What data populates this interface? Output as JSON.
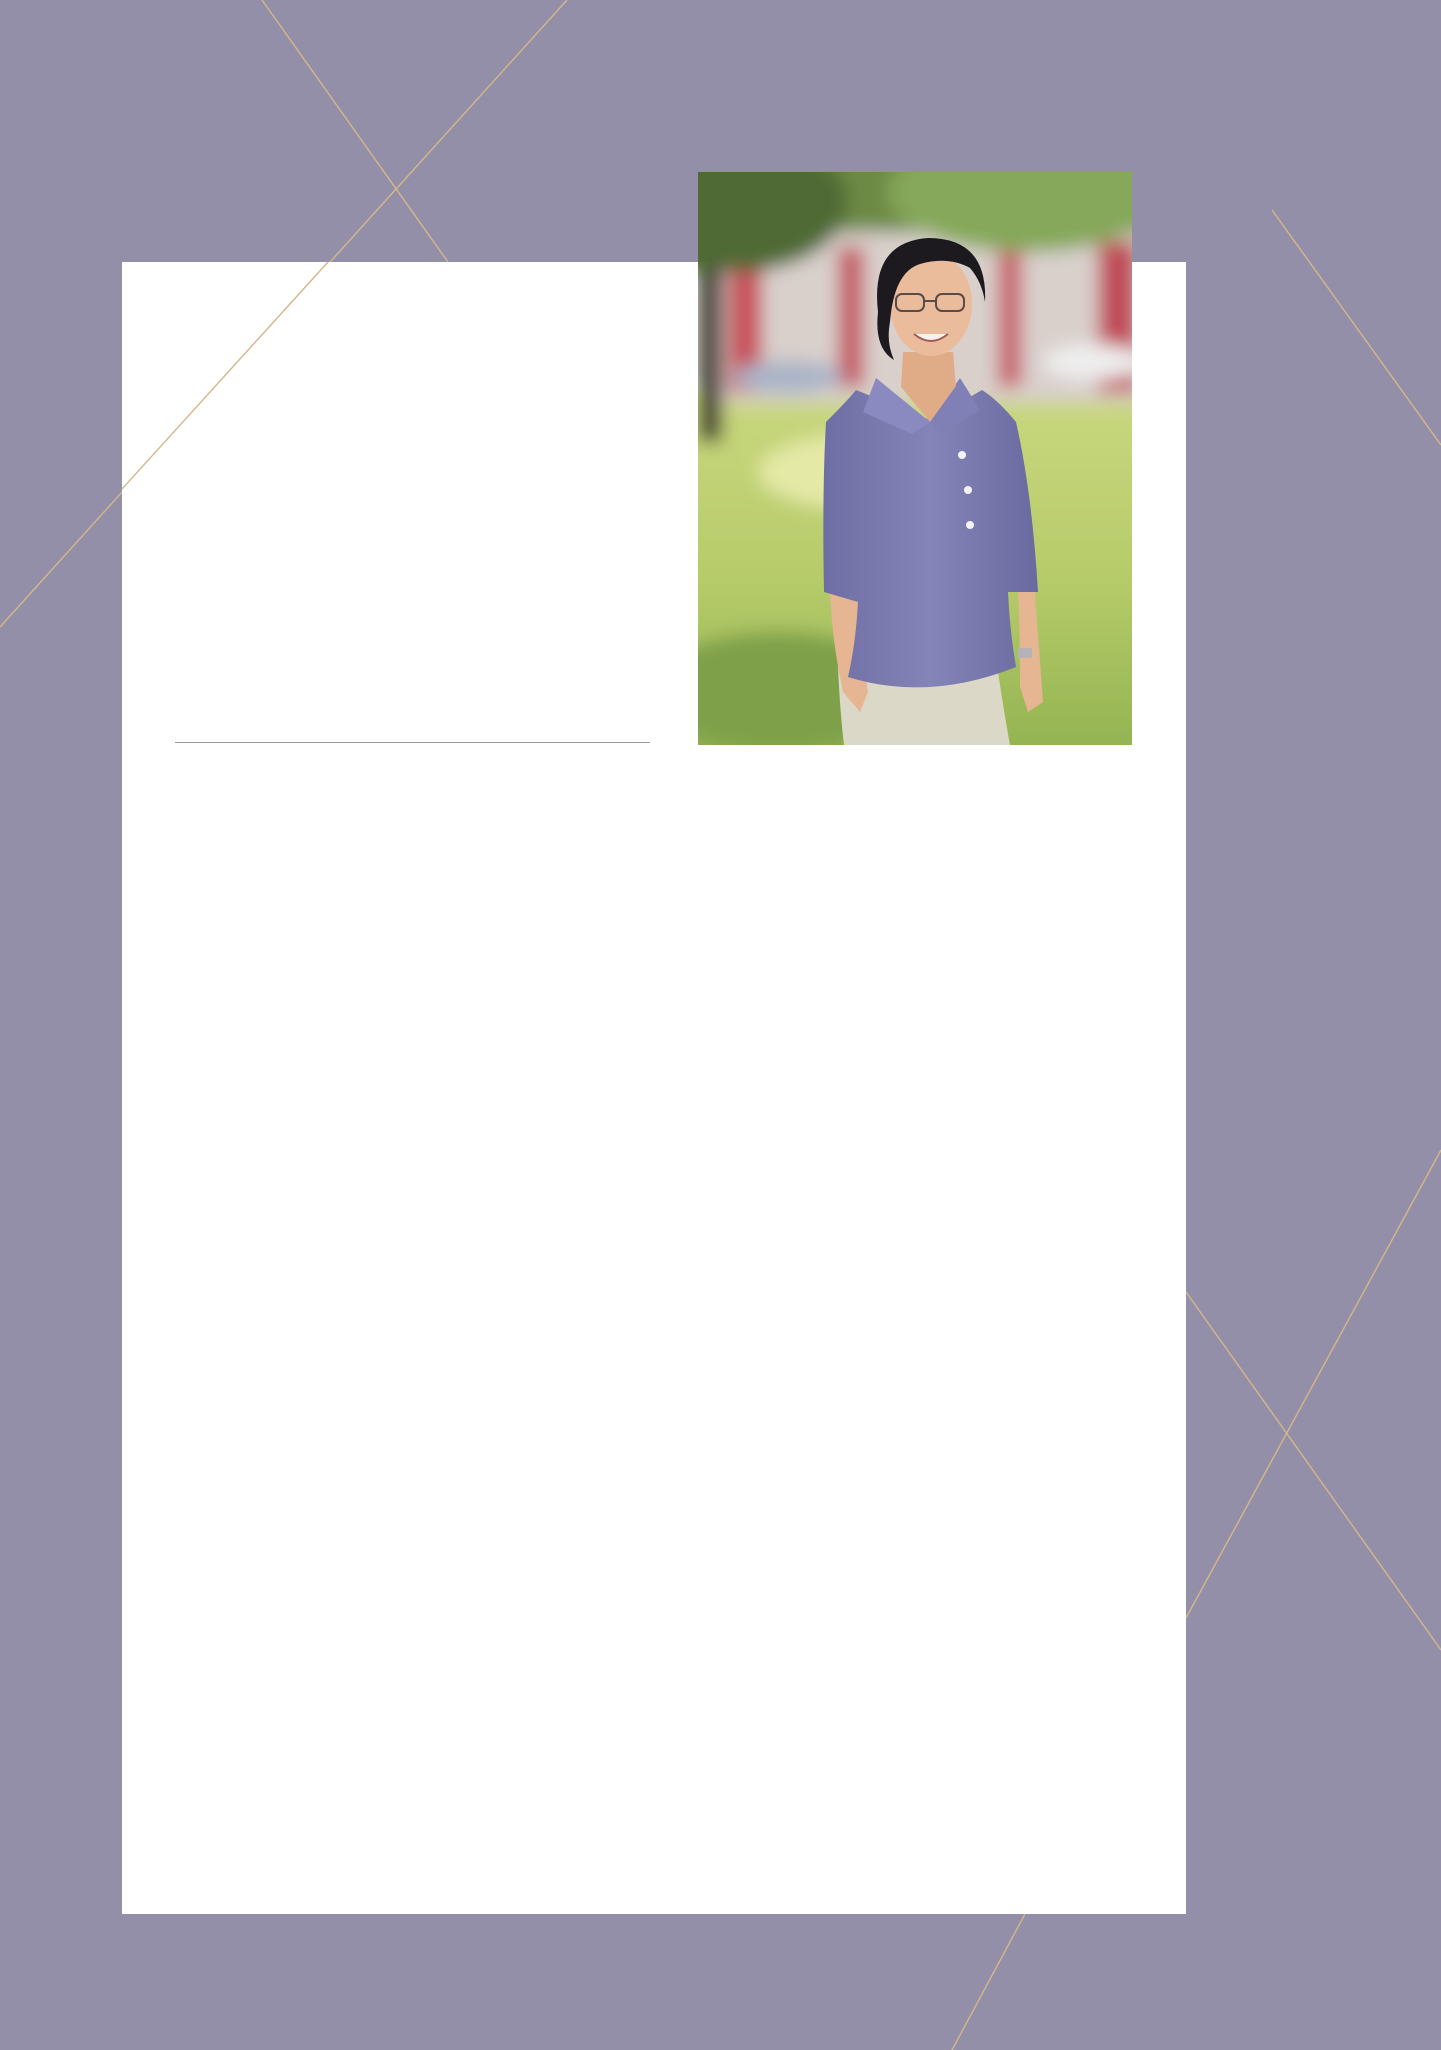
{
  "page": {
    "background_color": "#938fa9",
    "card_color": "#ffffff",
    "line_color": "#d2b889",
    "rule_color": "#9a9a9a"
  },
  "portrait": {
    "icon": "portrait-photo-icon",
    "colors": {
      "foliage": "#7a9a52",
      "grass": "#b8cc6c",
      "building": "#d8cdc9",
      "pillar": "#c8505a",
      "shirt": "#7c7cb0",
      "skin": "#e8b898",
      "hair": "#1c1a1e",
      "trousers": "#dcd8c8"
    }
  }
}
